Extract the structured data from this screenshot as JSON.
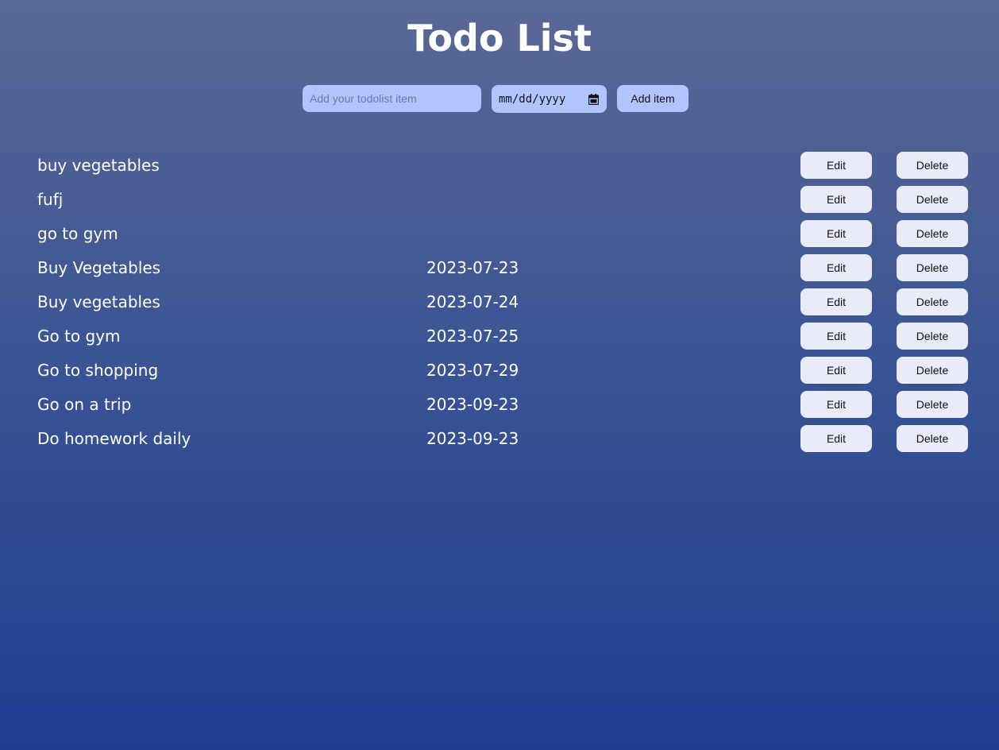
{
  "header": {
    "title": "Todo List"
  },
  "form": {
    "todo_placeholder": "Add your todolist item",
    "date_placeholder": "mm/dd/yyyy",
    "add_label": "Add item"
  },
  "colors": {
    "background_top": "#5a6895",
    "background_bottom": "#1e3d92",
    "input_bg": "#b0c4ff",
    "row_button_bg": "#e8ecfa"
  },
  "todos": [
    {
      "text": "buy vegetables",
      "date": "",
      "edit_label": "Edit",
      "delete_label": "Delete"
    },
    {
      "text": "fufj",
      "date": "",
      "edit_label": "Edit",
      "delete_label": "Delete"
    },
    {
      "text": "go to gym",
      "date": "",
      "edit_label": "Edit",
      "delete_label": "Delete"
    },
    {
      "text": "Buy Vegetables",
      "date": "2023-07-23",
      "edit_label": "Edit",
      "delete_label": "Delete"
    },
    {
      "text": "Buy vegetables",
      "date": "2023-07-24",
      "edit_label": "Edit",
      "delete_label": "Delete"
    },
    {
      "text": "Go to gym",
      "date": "2023-07-25",
      "edit_label": "Edit",
      "delete_label": "Delete"
    },
    {
      "text": "Go to shopping",
      "date": "2023-07-29",
      "edit_label": "Edit",
      "delete_label": "Delete"
    },
    {
      "text": "Go on a trip",
      "date": "2023-09-23",
      "edit_label": "Edit",
      "delete_label": "Delete"
    },
    {
      "text": "Do homework daily",
      "date": "2023-09-23",
      "edit_label": "Edit",
      "delete_label": "Delete"
    }
  ]
}
